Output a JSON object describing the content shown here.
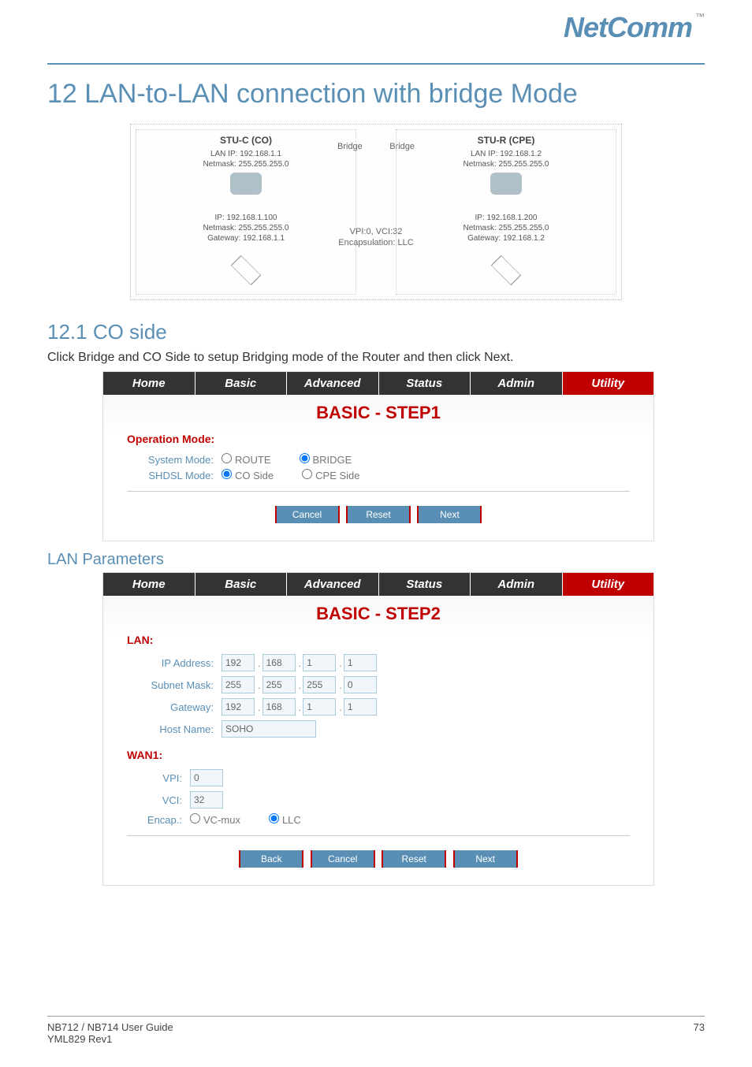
{
  "brand": {
    "name": "NetComm",
    "tm": "™"
  },
  "page_title": "12 LAN-to-LAN connection with bridge Mode",
  "diagram": {
    "left": {
      "title": "STU-C (CO)",
      "lan_ip": "LAN IP: 192.168.1.1",
      "netmask": "Netmask: 255.255.255.0",
      "pc_ip": "IP: 192.168.1.100",
      "pc_netmask": "Netmask: 255.255.255.0",
      "pc_gateway": "Gateway: 192.168.1.1"
    },
    "right": {
      "title": "STU-R (CPE)",
      "lan_ip": "LAN IP: 192.168.1.2",
      "netmask": "Netmask: 255.255.255.0",
      "pc_ip": "IP: 192.168.1.200",
      "pc_netmask": "Netmask: 255.255.255.0",
      "pc_gateway": "Gateway: 192.168.1.2"
    },
    "mid": {
      "bridge_left": "Bridge",
      "bridge_right": "Bridge",
      "line1": "VPI:0, VCI:32",
      "line2": "Encapsulation: LLC"
    }
  },
  "section_12_1": {
    "title": "12.1 CO side",
    "text": "Click Bridge and CO Side to setup Bridging mode of the Router and then click Next."
  },
  "tabs": {
    "home": "Home",
    "basic": "Basic",
    "advanced": "Advanced",
    "status": "Status",
    "admin": "Admin",
    "utility": "Utility"
  },
  "step1": {
    "title": "BASIC - STEP1",
    "section": "Operation Mode:",
    "system_mode_label": "System Mode:",
    "system_mode_route": "ROUTE",
    "system_mode_bridge": "BRIDGE",
    "shdsl_mode_label": "SHDSL Mode:",
    "shdsl_co": "CO Side",
    "shdsl_cpe": "CPE Side",
    "buttons": {
      "cancel": "Cancel",
      "reset": "Reset",
      "next": "Next"
    }
  },
  "lan_params_title": "LAN Parameters",
  "step2": {
    "title": "BASIC - STEP2",
    "lan_section": "LAN:",
    "ip_label": "IP Address:",
    "ip": [
      "192",
      "168",
      "1",
      "1"
    ],
    "subnet_label": "Subnet Mask:",
    "subnet": [
      "255",
      "255",
      "255",
      "0"
    ],
    "gateway_label": "Gateway:",
    "gateway": [
      "192",
      "168",
      "1",
      "1"
    ],
    "hostname_label": "Host Name:",
    "hostname": "SOHO",
    "wan_section": "WAN1:",
    "vpi_label": "VPI:",
    "vpi": "0",
    "vci_label": "VCI:",
    "vci": "32",
    "encap_label": "Encap.:",
    "encap_vcmux": "VC-mux",
    "encap_llc": "LLC",
    "buttons": {
      "back": "Back",
      "cancel": "Cancel",
      "reset": "Reset",
      "next": "Next"
    }
  },
  "footer": {
    "left_line1": "NB712 / NB714 User Guide",
    "left_line2": "YML829 Rev1",
    "page_num": "73"
  }
}
